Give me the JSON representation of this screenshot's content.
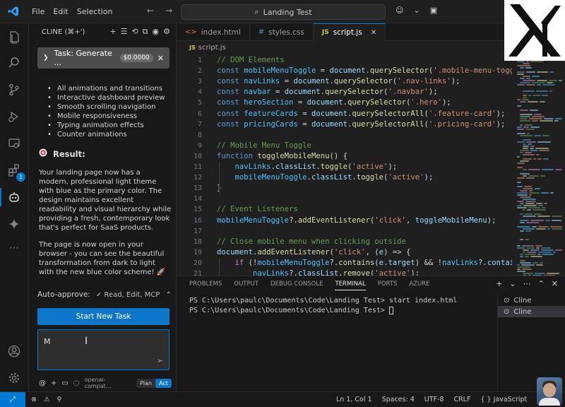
{
  "titlebar": {
    "menus": [
      "File",
      "Edit",
      "Selection"
    ],
    "search": "Landing Test"
  },
  "sidebar": {
    "header": "CLINE (⌘+')",
    "task_label": "Task: Generate ...",
    "task_cost": "$0.0000",
    "features": [
      "All animations and transitions",
      "Interactive dashboard preview",
      "Smooth scrolling navigation",
      "Mobile responsiveness",
      "Typing animation effects",
      "Counter animations"
    ],
    "result_title": "Result:",
    "result_paragraph_1": "Your landing page now has a modern, professional light theme with blue as the primary color. The design maintains excellent readability and visual hierarchy while providing a fresh, contemporary look that's perfect for SaaS products.",
    "result_paragraph_2": "The page is now open in your browser - you can see the beautiful transformation from dark to light with the new blue color scheme! 🚀",
    "auto_approve_label": "Auto-approve:",
    "auto_approve_value": "✓ Read, Edit, MCP",
    "start_button": "Start New Task",
    "input_value": "M",
    "model_label": "openai-compat...",
    "plan_label": "Plan",
    "act_label": "Act"
  },
  "tabs": [
    {
      "label": "index.html",
      "icon": "html-file-icon"
    },
    {
      "label": "styles.css",
      "icon": "css-file-icon"
    },
    {
      "label": "script.js",
      "icon": "js-file-icon",
      "active": true
    }
  ],
  "breadcrumb": "script.js",
  "code_lines": [
    {
      "n": "1",
      "text": "// DOM Elements"
    },
    {
      "n": "2",
      "text": "const mobileMenuToggle = document.querySelector('.mobile-menu-toggle"
    },
    {
      "n": "3",
      "text": "const navLinks = document.querySelector('.nav-links');"
    },
    {
      "n": "4",
      "text": "const navbar = document.querySelector('.navbar');"
    },
    {
      "n": "5",
      "text": "const heroSection = document.querySelector('.hero');"
    },
    {
      "n": "6",
      "text": "const featureCards = document.querySelectorAll('.feature-card');"
    },
    {
      "n": "7",
      "text": "const pricingCards = document.querySelectorAll('.pricing-card');"
    },
    {
      "n": "8",
      "text": ""
    },
    {
      "n": "9",
      "text": "// Mobile Menu Toggle"
    },
    {
      "n": "10",
      "text": "function toggleMobileMenu() {"
    },
    {
      "n": "11",
      "text": "    navLinks.classList.toggle('active');"
    },
    {
      "n": "12",
      "text": "    mobileMenuToggle.classList.toggle('active');"
    },
    {
      "n": "13",
      "text": "}"
    },
    {
      "n": "14",
      "text": ""
    },
    {
      "n": "15",
      "text": "// Event Listeners"
    },
    {
      "n": "16",
      "text": "mobileMenuToggle?.addEventListener('click', toggleMobileMenu);"
    },
    {
      "n": "17",
      "text": ""
    },
    {
      "n": "18",
      "text": "// Close mobile menu when clicking outside"
    },
    {
      "n": "19",
      "text": "document.addEventListener('click', (e) => {"
    },
    {
      "n": "20",
      "text": "    if (!mobileMenuToggle?.contains(e.target) && !navLinks?.contains"
    },
    {
      "n": "21",
      "text": "        navLinks?.classList.remove('active');"
    }
  ],
  "panel": {
    "tabs": [
      "PROBLEMS",
      "OUTPUT",
      "DEBUG CONSOLE",
      "TERMINAL",
      "PORTS",
      "AZURE"
    ],
    "active_tab": "TERMINAL",
    "terminal_lines": [
      "PS C:\\Users\\paulc\\Documents\\Code\\Landing Test> start index.html",
      "PS C:\\Users\\paulc\\Documents\\Code\\Landing Test> "
    ],
    "terminals": [
      "Cline",
      "Cline"
    ]
  },
  "statusbar": {
    "position": "Ln 1, Col 1",
    "spaces": "Spaces: 4",
    "encoding": "UTF-8",
    "eol": "CRLF",
    "language": "JavaScript"
  },
  "colors": {
    "accent": "#0078d4",
    "button": "#0e76c9"
  }
}
